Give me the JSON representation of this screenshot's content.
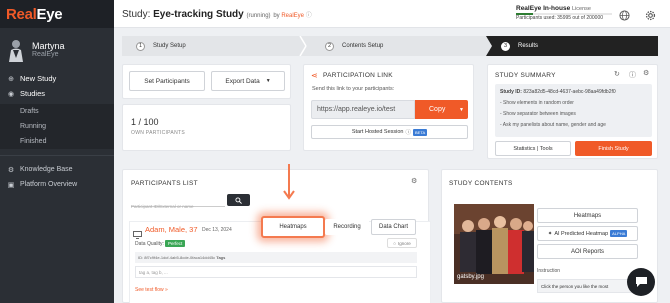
{
  "sidebar": {
    "logo_part1": "Real",
    "logo_part2": "Eye",
    "user_name": "Martyna",
    "user_org": "RealEye",
    "items": [
      {
        "label": "New Study"
      },
      {
        "label": "Studies"
      },
      {
        "label": "Drafts"
      },
      {
        "label": "Running"
      },
      {
        "label": "Finished"
      },
      {
        "label": "Knowledge Base"
      },
      {
        "label": "Platform Overview"
      }
    ]
  },
  "header": {
    "title_prefix": "Study: ",
    "title": "Eye-tracking Study",
    "state": "(running)",
    "by_prefix": "by",
    "by_name": "RealEye",
    "license_name": "RealEye In-house",
    "license_label": "License",
    "participants_used": "Participants used: 35995 out of 200000"
  },
  "stepper": {
    "steps": [
      {
        "num": "1",
        "label": "Study Setup"
      },
      {
        "num": "2",
        "label": "Contents Setup"
      },
      {
        "num": "3",
        "label": "Results"
      }
    ]
  },
  "participants_panel": {
    "set_participants": "Set Participants",
    "export_data": "Export Data",
    "count": "1 / 100",
    "own_participants": "OWN PARTICIPANTS"
  },
  "participation_link": {
    "title": "PARTICIPATION LINK",
    "description": "Send this link to your participants:",
    "url": "https://app.realeye.io/test",
    "copy": "Copy",
    "hosted_session": "Start Hosted Session",
    "beta": "BETA"
  },
  "study_summary": {
    "title": "STUDY SUMMARY",
    "study_id_label": "Study ID:",
    "study_id": "823a82d5-48cd-4637-aebc-98aa49fdb2f0",
    "lines": [
      "- Show elements in random order",
      "- Show separator between images",
      "- Ask my panelists about name, gender and age"
    ],
    "statistics_tools": "Statistics | Tools",
    "finish_study": "Finish Study"
  },
  "participants_list": {
    "title": "PARTICIPANTS LIST",
    "search_placeholder": "Participant ID/External or name",
    "participant_name": "Adam, Male, 37",
    "date": "Dec 13, 2024",
    "data_quality_label": "Data Quality:",
    "quality": "Perfect",
    "ignore": "Ignore",
    "heatmaps": "Heatmaps",
    "recording": "Recording",
    "data_chart": "Data Chart",
    "id_line": "ID: 8f7c9f4e-1dcf-4ab5-8cde-0faca14dd45c",
    "tags_label": "Tags",
    "tags_placeholder": "tag a, tag b, ...",
    "see_flow": "See test flow »"
  },
  "study_contents": {
    "title": "STUDY CONTENTS",
    "heatmaps": "Heatmaps",
    "ai_heatmap": "AI Predicted Heatmap",
    "alpha": "ALPHA",
    "aoi_reports": "AOI Reports",
    "image_name": "gatsby.jpg",
    "instruction_label": "Instruction",
    "instruction_text": "Click the person you like the most"
  },
  "colors": {
    "accent": "#f05a28",
    "sidebar": "#2b2f35",
    "success": "#3aa655"
  }
}
